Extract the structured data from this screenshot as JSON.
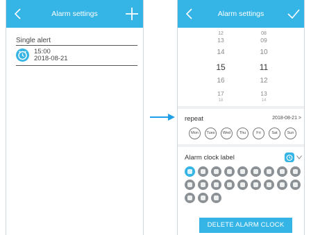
{
  "colors": {
    "accent": "#35b4e6",
    "icon_gray": "#8c9196",
    "arrow": "#1e9fe8"
  },
  "left_screen": {
    "title": "Alarm settings",
    "back_icon": "chevron-left-icon",
    "add_icon": "plus-icon",
    "section_label": "Single alert",
    "alarm": {
      "icon": "alarm-clock-icon",
      "time": "15:00",
      "date": "2018-08-21"
    }
  },
  "transition_arrow": "arrow-right-icon",
  "right_screen": {
    "title": "Alarm settings",
    "back_icon": "chevron-left-icon",
    "confirm_icon": "check-icon",
    "picker": {
      "hours": [
        "12",
        "13",
        "14",
        "15",
        "16",
        "17",
        "18"
      ],
      "minutes": [
        "08",
        "09",
        "10",
        "11",
        "12",
        "13",
        "14"
      ],
      "selected_hour": "15",
      "selected_minute": "11"
    },
    "repeat": {
      "label": "repeat",
      "date": "2018-08-21 >",
      "days": [
        "Mon",
        "Tues",
        "Wed",
        "Thu",
        "Fri",
        "Sat",
        "Sun"
      ]
    },
    "alarm_clock_label": {
      "label": "Alarm clock label",
      "selected_icon": "alarm-clock-icon",
      "expand_icon": "chevron-down-icon",
      "icons": [
        "alarm-clock-icon",
        "moon-icon",
        "running-icon",
        "coffee-icon",
        "pill-icon",
        "briefcase-icon",
        "message-icon",
        "soccer-icon",
        "phone-icon",
        "cart-icon",
        "bag-icon",
        "laptop-icon",
        "flower-icon",
        "bike-icon",
        "bottle-icon",
        "family-icon",
        "refresh-icon",
        "camera-icon",
        "no-smoking-icon",
        "leaf-icon",
        "car-icon"
      ],
      "selected_index": 0
    },
    "delete_label": "DELETE ALARM CLOCK"
  }
}
